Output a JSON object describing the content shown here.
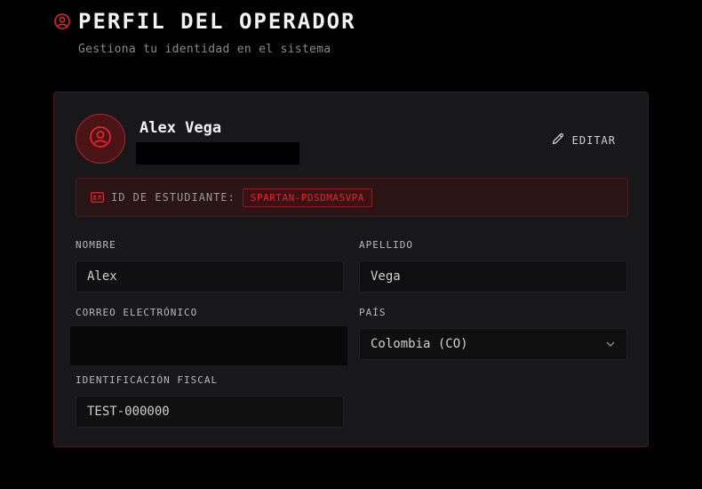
{
  "header": {
    "title": "PERFIL DEL OPERADOR",
    "subtitle": "Gestiona tu identidad en el sistema"
  },
  "profile": {
    "name": "Alex Vega",
    "edit_label": "EDITAR",
    "id_label": "ID DE ESTUDIANTE:",
    "id_value": "SPARTAN-PDSDMA5VPA"
  },
  "form": {
    "first_name": {
      "label": "NOMBRE",
      "value": "Alex"
    },
    "last_name": {
      "label": "APELLIDO",
      "value": "Vega"
    },
    "email": {
      "label": "CORREO ELECTRÓNICO",
      "value": ""
    },
    "country": {
      "label": "PAÍS",
      "value": "Colombia (CO)"
    },
    "tax_id": {
      "label": "IDENTIFICACIÓN FISCAL",
      "value": "TEST-000000"
    }
  },
  "colors": {
    "accent": "#e0262e",
    "background": "#000000",
    "card": "#18181b"
  },
  "icons": {
    "title": "user-circle-icon",
    "avatar": "user-circle-icon",
    "edit": "pencil-icon",
    "id": "id-card-icon",
    "select": "chevron-down-icon"
  }
}
